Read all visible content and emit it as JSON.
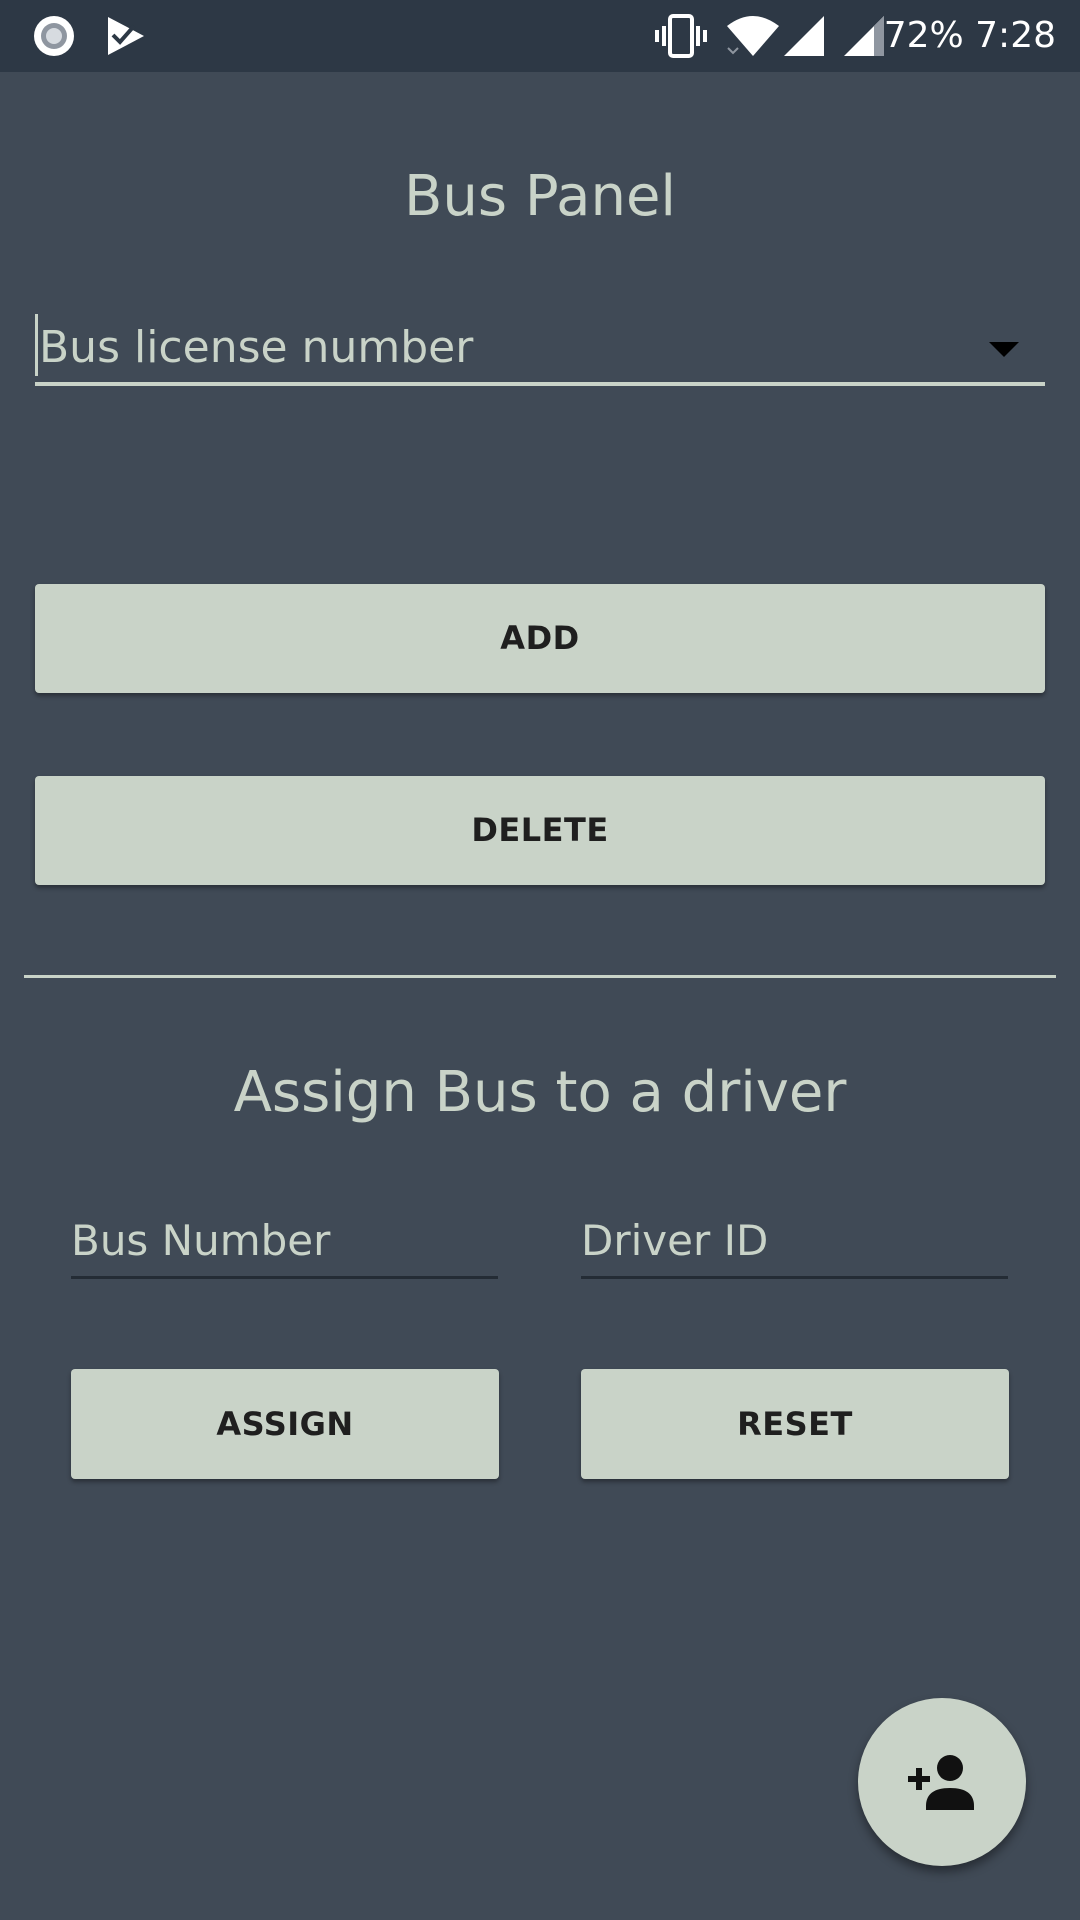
{
  "status_bar": {
    "battery": "72%",
    "time": "7:28",
    "icons": [
      "record-icon",
      "checklist-app-icon",
      "vibrate-icon",
      "wifi-icon",
      "cell-signal-icon",
      "cell-signal-icon"
    ]
  },
  "bus_panel": {
    "title": "Bus Panel",
    "spinner_placeholder": "Bus license number",
    "add_label": "ADD",
    "delete_label": "DELETE"
  },
  "assign": {
    "title": "Assign Bus to a driver",
    "bus_number_placeholder": "Bus Number",
    "driver_id_placeholder": "Driver ID",
    "assign_label": "ASSIGN",
    "reset_label": "RESET"
  },
  "fab": {
    "icon": "add-person-icon"
  },
  "colors": {
    "background": "#404a56",
    "status_bar": "#2d3845",
    "accent": "#c9d3c8",
    "button_text": "#1f1f1f"
  }
}
